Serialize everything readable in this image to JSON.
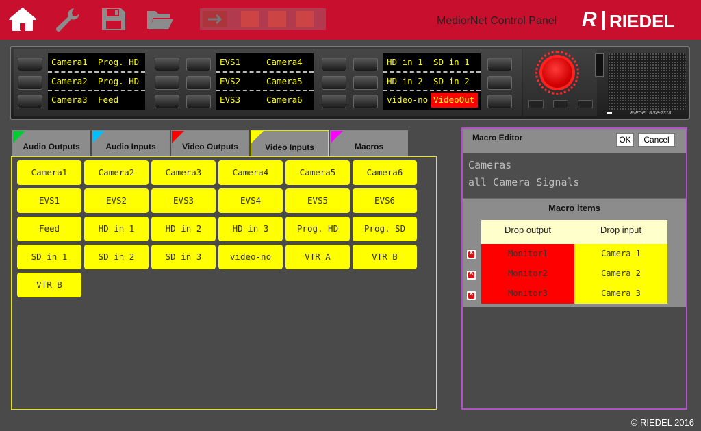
{
  "header": {
    "title": "MediorNet Control Panel",
    "logo_text": "RIEDEL",
    "logo_mark": "R",
    "icons": [
      "home-icon",
      "wrench-icon",
      "save-icon",
      "folder-icon",
      "transfer-strip-icon"
    ]
  },
  "device": {
    "label": "RIEDEL RSP-2318",
    "displays": [
      [
        [
          "Camera1",
          "Prog. HD"
        ],
        [
          "Camera2",
          "Prog. HD"
        ],
        [
          "Camera3",
          "Feed"
        ]
      ],
      [
        [
          "EVS1",
          "Camera4"
        ],
        [
          "EVS2",
          "Camera5"
        ],
        [
          "EVS3",
          "Camera6"
        ]
      ],
      [
        [
          "HD in 1",
          "SD in 1"
        ],
        [
          "HD in 2",
          "SD in 2"
        ],
        [
          "video-no",
          "VideoOut"
        ]
      ]
    ]
  },
  "tabs": [
    {
      "label": "Audio Outputs",
      "color": "#00cc33"
    },
    {
      "label": "Audio Inputs",
      "color": "#00bfff"
    },
    {
      "label": "Video Outputs",
      "color": "#ff0000"
    },
    {
      "label": "Video Inputs",
      "color": "#ffff00"
    },
    {
      "label": "Macros",
      "color": "#ff00ff"
    }
  ],
  "grid_buttons": [
    "Camera1",
    "Camera2",
    "Camera3",
    "Camera4",
    "Camera5",
    "Camera6",
    "EVS1",
    "EVS2",
    "EVS3",
    "EVS4",
    "EVS5",
    "EVS6",
    "Feed",
    "HD in 1",
    "HD in 2",
    "HD in 3",
    "Prog. HD",
    "Prog. SD",
    "SD in 1",
    "SD in 2",
    "SD in 3",
    "video-no",
    "VTR A",
    "VTR B",
    "VTR B"
  ],
  "macro_editor": {
    "title": "Macro Editor",
    "ok_label": "OK",
    "cancel_label": "Cancel",
    "name": "Cameras",
    "description": "all Camera Signals",
    "items_title": "Macro items",
    "col_output": "Drop output",
    "col_input": "Drop input",
    "items": [
      {
        "output": "Monitor1",
        "input": "Camera 1"
      },
      {
        "output": "Monitor2",
        "input": "Camera 2"
      },
      {
        "output": "Monitor3",
        "input": "Camera 3"
      }
    ]
  },
  "colors": {
    "header_red": "#c8102e",
    "accent_yellow": "#ffff00",
    "macro_border": "#b34fcc"
  },
  "footer": {
    "copyright": "© RIEDEL 2016"
  }
}
